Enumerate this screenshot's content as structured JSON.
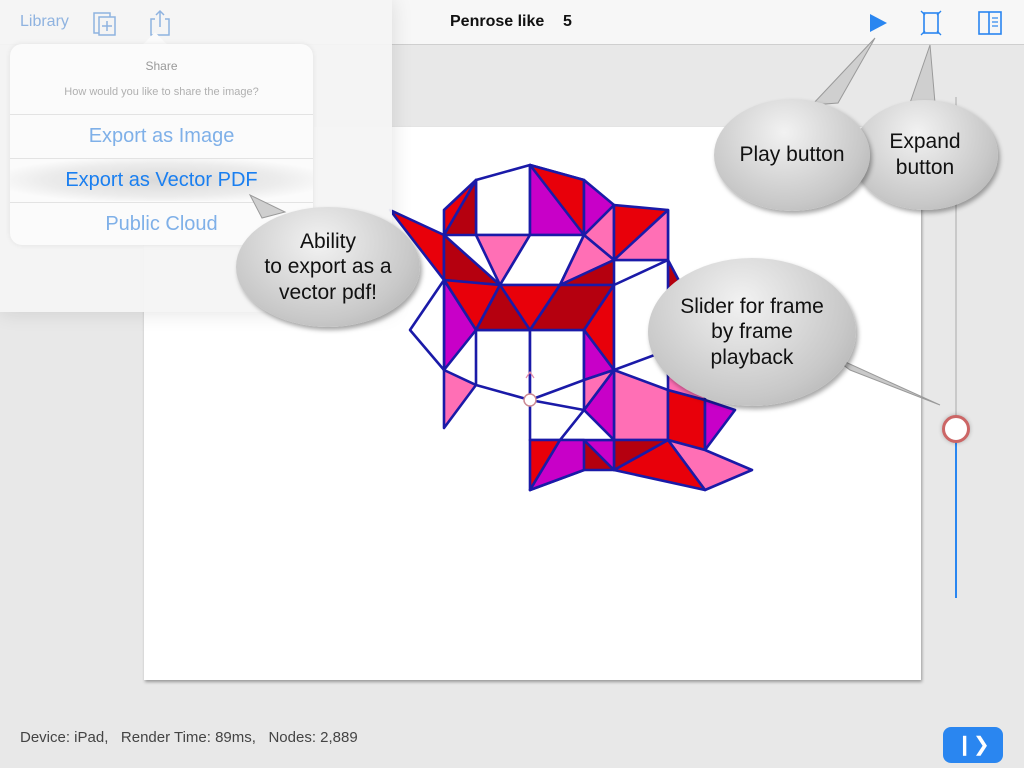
{
  "topbar": {
    "library_label": "Library",
    "title": "Penrose like",
    "count": "5"
  },
  "icons": {
    "new_document": "new-document-icon",
    "share": "share-icon",
    "play": "play-icon",
    "expand": "expand-icon",
    "panels": "panels-icon"
  },
  "share_sheet": {
    "title": "Share",
    "subtitle": "How would you like to share the image?",
    "options": [
      {
        "label": "Export as Image"
      },
      {
        "label": "Export as Vector PDF"
      },
      {
        "label": "Public Cloud"
      }
    ]
  },
  "callouts": {
    "play": "Play button",
    "expand": "Expand\nbutton",
    "export": "Ability\nto export as a\nvector pdf!",
    "slider": "Slider for frame\nby frame\nplayback"
  },
  "status": {
    "device": "Device: iPad,",
    "render_time": "Render Time: 89ms,",
    "nodes": "Nodes: 2,889"
  },
  "frame_button": {
    "label": "❙❯"
  },
  "colors": {
    "accent_blue": "#2a86f0",
    "link_blue_faded": "#8fb3e0",
    "tile_outline": "#1a1aa8",
    "tile_red": "#e8000a",
    "tile_dark_red": "#b5000f",
    "tile_magenta": "#c800c8",
    "tile_pink": "#ff6fb5"
  }
}
